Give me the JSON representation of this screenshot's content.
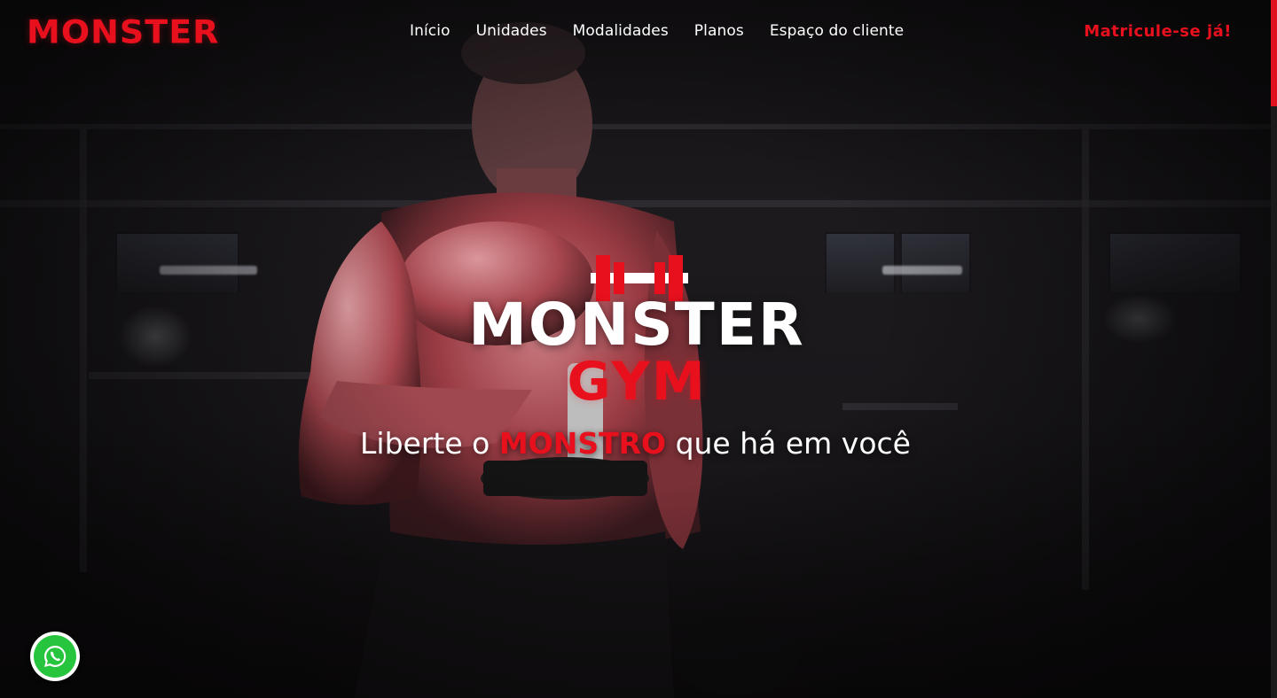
{
  "header": {
    "logo": "MONSTER",
    "nav": [
      {
        "label": "Início"
      },
      {
        "label": "Unidades"
      },
      {
        "label": "Modalidades"
      },
      {
        "label": "Planos"
      },
      {
        "label": "Espaço do cliente"
      }
    ],
    "cta_label": "Matricule-se já!"
  },
  "hero": {
    "brand_main": "MONSTER",
    "brand_sub": "GYM",
    "tagline_before": "Liberte o ",
    "tagline_accent": "MONSTRO",
    "tagline_after": " que há em você",
    "icons": {
      "brand": "dumbbell-icon",
      "chat": "whatsapp-icon"
    }
  },
  "colors": {
    "accent": "#e8101d",
    "background": "#0c0a0b",
    "text": "#ffffff",
    "whatsapp": "#27c43d"
  }
}
